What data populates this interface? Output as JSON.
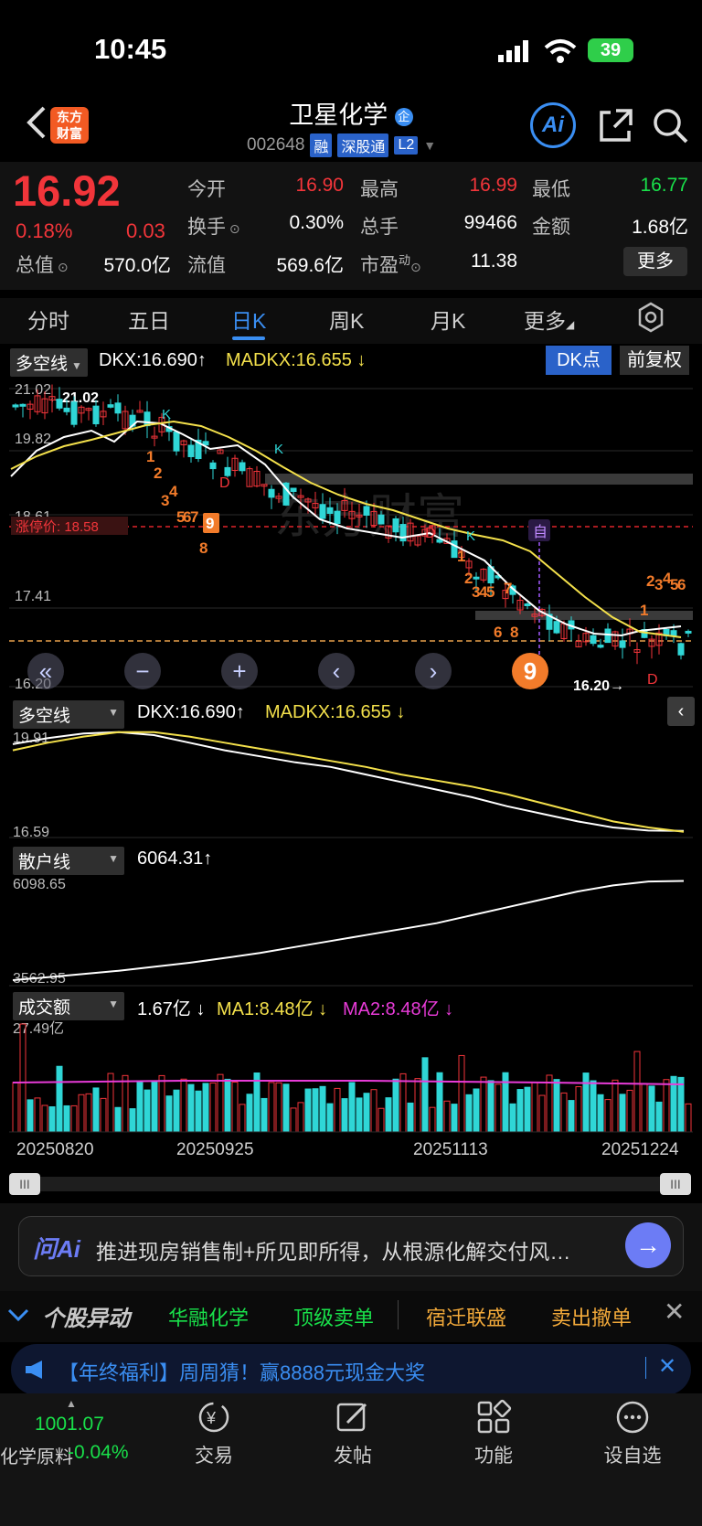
{
  "status": {
    "time": "10:45",
    "battery": "39"
  },
  "header": {
    "logo_line1": "东方",
    "logo_line2": "财富",
    "stock_name": "卫星化学",
    "stock_code": "002648",
    "tags": [
      "融",
      "深股通",
      "L2"
    ],
    "ai_label": "Ai"
  },
  "quote": {
    "price": "16.92",
    "change_pct": "0.18%",
    "change": "0.03",
    "open_label": "今开",
    "open": "16.90",
    "high_label": "最高",
    "high": "16.99",
    "low_label": "最低",
    "low": "16.77",
    "turnover_label": "换手",
    "turnover": "0.30%",
    "volume_label": "总手",
    "volume": "99466",
    "amount_label": "金额",
    "amount": "1.68亿",
    "mktcap_label": "总值",
    "mktcap": "570.0亿",
    "float_label": "流值",
    "float_cap": "569.6亿",
    "pe_label": "市盈",
    "pe_sup": "动",
    "pe": "11.38",
    "more_label": "更多"
  },
  "tabs": [
    "分时",
    "五日",
    "日K",
    "周K",
    "月K",
    "更多"
  ],
  "main_chart": {
    "indicator": "多空线",
    "dkx": "DKX:16.690",
    "dkx_arrow": "↑",
    "madkx": "MADKX:16.655",
    "madkx_arrow": "↓",
    "dk_button": "DK点",
    "restore_button": "前复权",
    "y_labels": [
      "21.02",
      "19.82",
      "18.61",
      "17.41",
      "16.20"
    ],
    "max_marker": "←21.02",
    "min_marker": "16.20→",
    "limit_label": "涨停价: 18.58",
    "self_tag": "自",
    "watermark": "东方财富"
  },
  "chart_data": [
    {
      "type": "line",
      "title": "多空线",
      "series": [
        {
          "name": "DKX",
          "values": [
            19.55,
            19.75,
            19.9,
            19.95,
            19.85,
            19.6,
            19.35,
            19.15,
            18.95,
            18.8,
            18.55,
            18.3,
            18.05,
            17.8,
            17.5,
            17.25,
            17.0,
            16.8,
            16.7,
            16.69
          ]
        },
        {
          "name": "MADKX",
          "values": [
            19.35,
            19.6,
            19.8,
            19.95,
            19.95,
            19.8,
            19.6,
            19.4,
            19.2,
            19.0,
            18.8,
            18.55,
            18.35,
            18.15,
            17.9,
            17.6,
            17.3,
            17.0,
            16.8,
            16.655
          ]
        }
      ],
      "ylim": [
        16.59,
        19.91
      ]
    },
    {
      "type": "line",
      "title": "散户线",
      "series": [
        {
          "name": "散户线",
          "values": [
            3562.95,
            3640,
            3720,
            3800,
            3900,
            4000,
            4120,
            4250,
            4400,
            4550,
            4700,
            4850,
            5000,
            5200,
            5400,
            5600,
            5800,
            5950,
            6050,
            6064.31
          ]
        }
      ],
      "ylim": [
        3562.95,
        6098.65
      ]
    },
    {
      "type": "bar",
      "title": "成交额",
      "categories": [
        "20250820",
        "20250925",
        "20251113",
        "20251224"
      ],
      "ylim": [
        0,
        27.49
      ]
    }
  ],
  "sub1": {
    "indicator": "多空线",
    "dkx": "DKX:16.690",
    "madkx": "MADKX:16.655",
    "y_top": "19.91",
    "y_bottom": "16.59"
  },
  "sub2": {
    "indicator": "散户线",
    "value": "6064.31",
    "y_top": "6098.65",
    "y_bottom": "3562.95"
  },
  "sub3": {
    "indicator": "成交额",
    "value": "1.67亿",
    "ma1": "MA1:8.48亿",
    "ma2": "MA2:8.48亿",
    "y_top": "27.49亿"
  },
  "dates": [
    "20250820",
    "20250925",
    "20251113",
    "20251224"
  ],
  "ai_bar": {
    "logo": "问Ai",
    "hint": "推进现房销售制+所见即所得，从根源化解交付风…"
  },
  "ticker": {
    "title": "个股异动",
    "items": [
      "华融化学",
      "顶级卖单",
      "宿迁联盛",
      "卖出撤单"
    ]
  },
  "promo": {
    "text": "【年终福利】周周猜！赢8888元现金大奖"
  },
  "bottom_nav": {
    "index_value": "1001.07",
    "index_name": "化学原料",
    "index_change": "-0.04%",
    "items": [
      "交易",
      "发帖",
      "功能",
      "设自选"
    ]
  },
  "colors": {
    "up": "#f2353a",
    "down": "#19e04a",
    "accent": "#3a8ef2",
    "candle_down": "#2fd6d6"
  }
}
